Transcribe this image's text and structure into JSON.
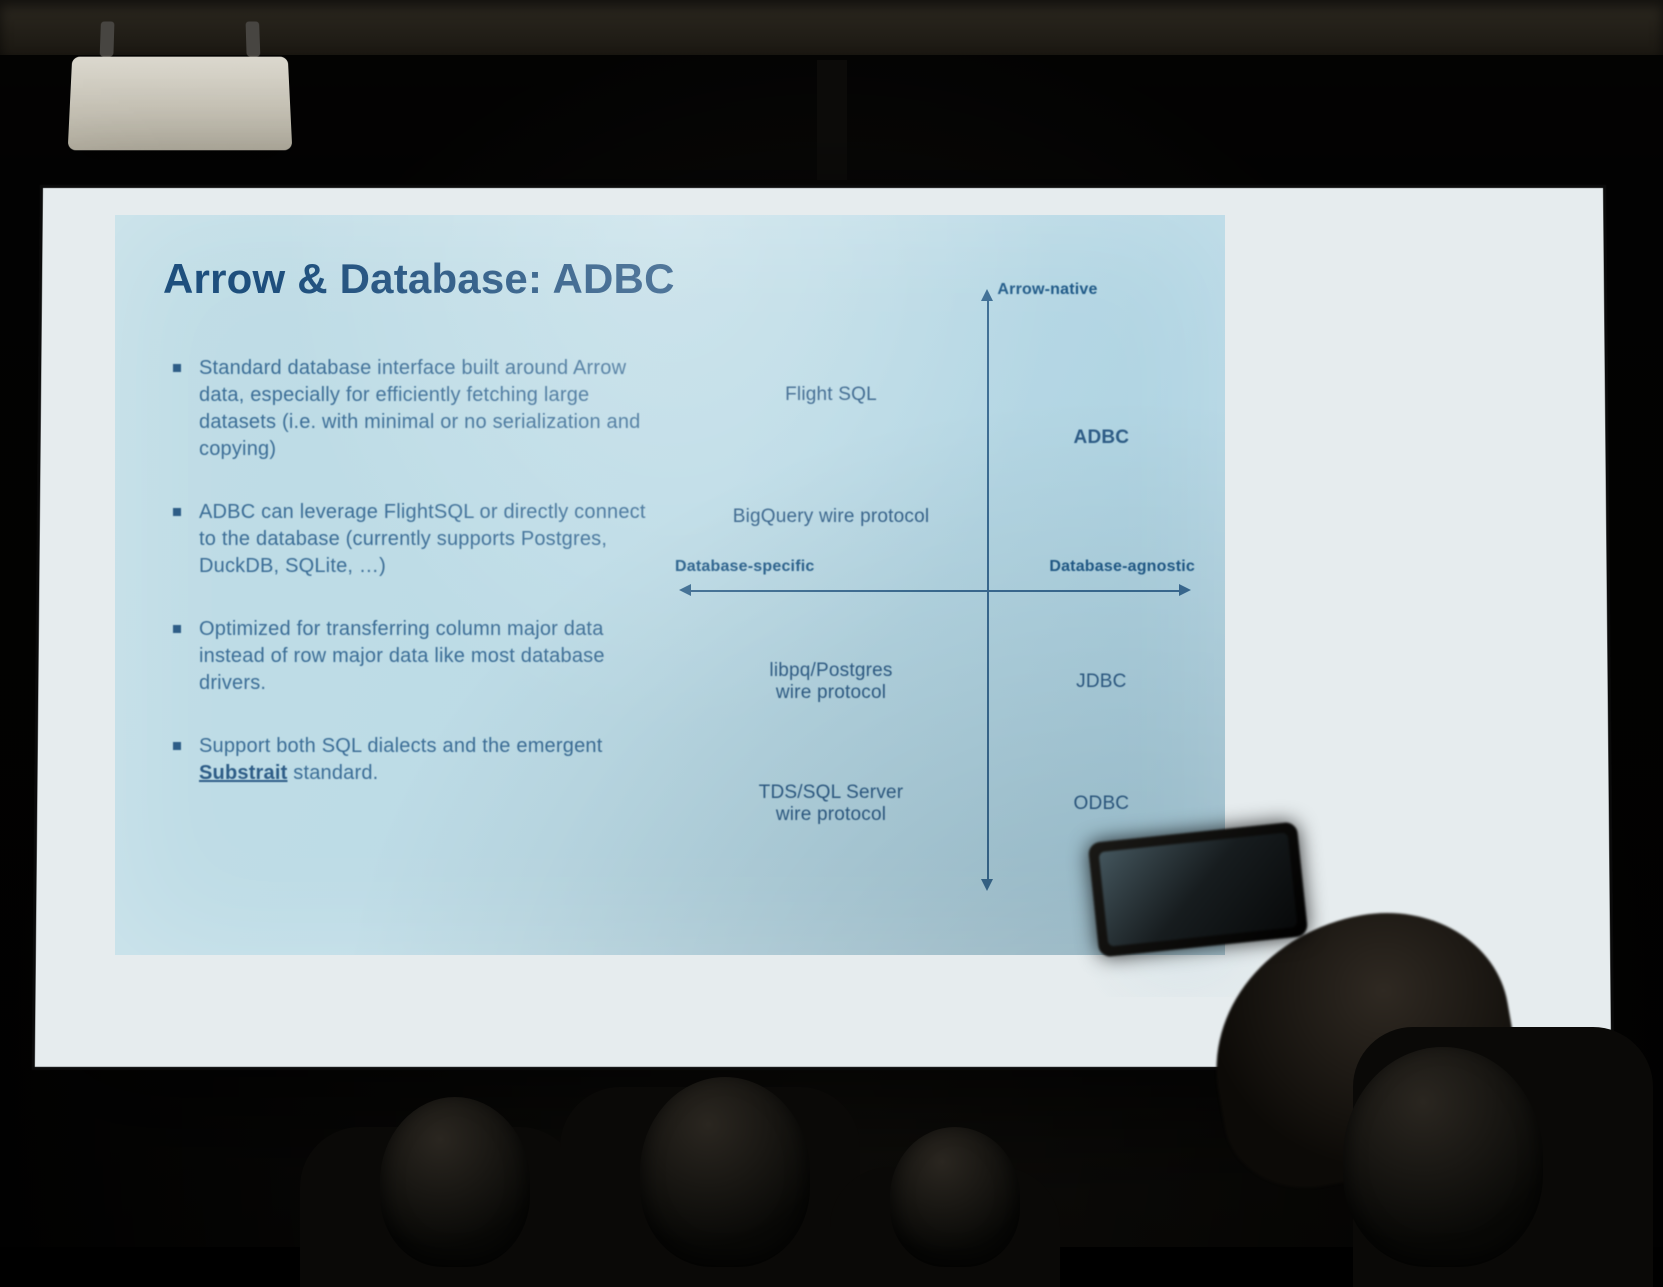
{
  "slide": {
    "title": "Arrow & Database: ADBC",
    "bullets": [
      "Standard database interface built around Arrow data, especially for efficiently fetching large datasets (i.e. with minimal or no serialization and copying)",
      "ADBC can leverage FlightSQL or directly connect to the database (currently supports Postgres, DuckDB, SQLite, …)",
      "Optimized for transferring column major data instead of row major data like most database drivers.",
      "Support both SQL dialects and the emergent <b>Substrait</b> standard."
    ]
  },
  "chart_data": {
    "type": "quadrant",
    "x_axis": {
      "left_label": "Database-specific",
      "right_label": "Database-agnostic"
    },
    "y_axis": {
      "top_label": "Arrow-native",
      "bottom_label": ""
    },
    "items": [
      {
        "label": "Flight SQL",
        "x": 30,
        "y": 18
      },
      {
        "label": "BigQuery wire protocol",
        "x": 30,
        "y": 38
      },
      {
        "label": "ADBC",
        "x": 82,
        "y": 25
      },
      {
        "label": "libpq/Postgres\nwire protocol",
        "x": 30,
        "y": 65
      },
      {
        "label": "TDS/SQL Server\nwire protocol",
        "x": 30,
        "y": 85
      },
      {
        "label": "JDBC",
        "x": 82,
        "y": 65
      },
      {
        "label": "ODBC",
        "x": 82,
        "y": 85
      }
    ]
  }
}
